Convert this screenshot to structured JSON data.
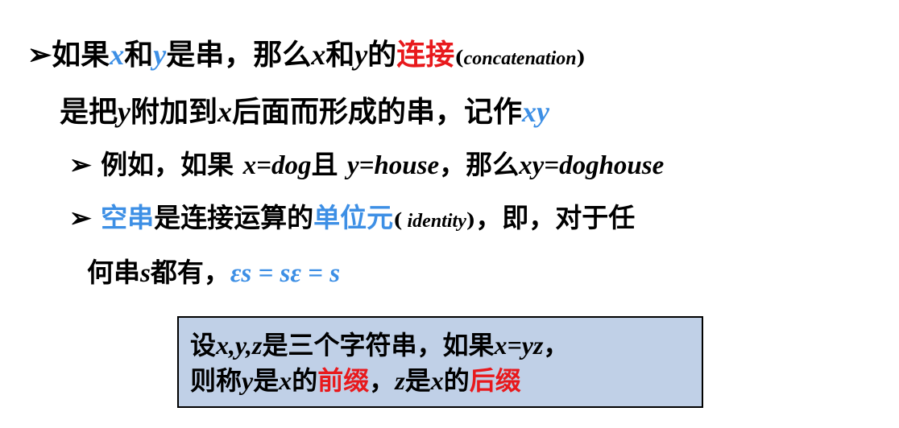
{
  "l1": {
    "bullet": "➢",
    "t1": "如果",
    "x": "x",
    "t2": "和",
    "y": "y",
    "t3": "是串，那么",
    "x2": "x",
    "t4": "和",
    "y2": "y",
    "t5": "的",
    "concat": "连接",
    "paren_open": "(",
    "concat_en": "concatenation",
    "paren_close": ")"
  },
  "l2": {
    "t1": "是把",
    "y": "y",
    "t2": "附加到",
    "x": "x",
    "t3": "后面而形成的串，记作",
    "xy": "xy"
  },
  "l3": {
    "bullet": "➢",
    "t1": "例如，如果",
    "xeq": "x=dog",
    "t2": "且",
    "yeq": "y=house",
    "t3": "，那么",
    "xyeq": "xy=doghouse"
  },
  "l4": {
    "bullet": "➢",
    "empty": "空串",
    "t1": "是连接运算的",
    "unit": "单位元",
    "paren_open": "(",
    "identity": " identity",
    "paren_close": ")",
    "t2": "，即，对于任"
  },
  "l5": {
    "t1": "何串",
    "s": "s",
    "t2": "都有，",
    "formula": "εs = sε = s"
  },
  "box": {
    "t1": "设",
    "xyz": "x,y,z",
    "t2": "是三个字符串，如果",
    "xeqyz": "x=yz",
    "t3": "，",
    "t4": "则称",
    "y": "y",
    "t5": "是",
    "x": "x",
    "t6": "的",
    "prefix": "前缀",
    "t7": "，",
    "z": "z",
    "t8": "是",
    "x2": "x",
    "t9": "的",
    "suffix": "后缀"
  },
  "colors": {
    "blue": "#3d8fe5",
    "red": "#e8191c",
    "box_bg": "#c0d0e7"
  }
}
